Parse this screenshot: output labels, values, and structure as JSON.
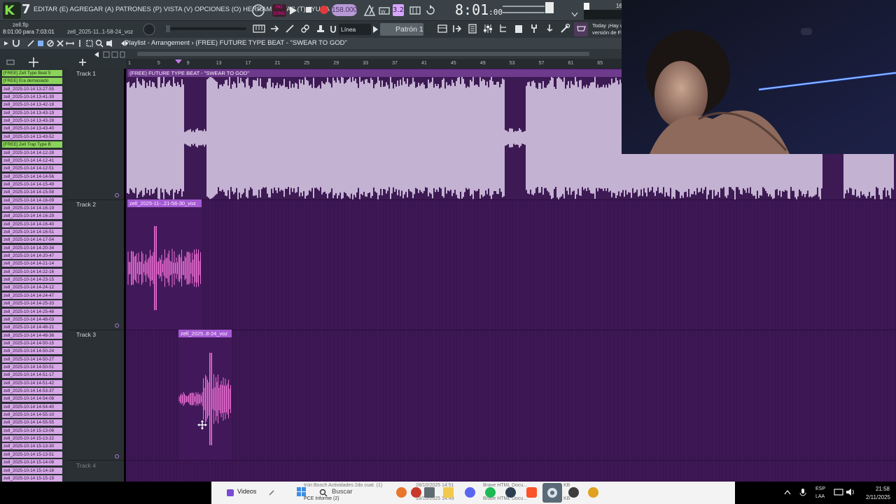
{
  "app": {
    "menu_text": "EDITAR (E)  AGREGAR (A)  PATRONES (P)  VISTA (V)  OPCIONES (O)  HERRAMIENTAS (T)  AYUDA",
    "tempo": "158.000",
    "song_time": "8:01",
    "song_time_frac": ":00",
    "file_name": "zell.flp",
    "time_info": "8:01:00 para 7:03:01",
    "voz_hint": "zell_2025-11..1-58-24_voz",
    "snap_mode": "Línea",
    "pattern": "Patrón 1",
    "today_line1": "Today  ¡Hay u",
    "today_line2": "versión de FL",
    "pattern_num": "3.2",
    "counter": "16"
  },
  "playlist": {
    "title": "Playlist - Arrangement  ›  (FREE) FUTURE TYPE BEAT - \"SWEAR TO GOD\"",
    "ruler": [
      "1",
      "5",
      "9",
      "13",
      "17",
      "21",
      "25",
      "29",
      "33",
      "37",
      "41",
      "45",
      "49",
      "53",
      "57",
      "61",
      "65",
      "67"
    ],
    "tracks": [
      "Track 1",
      "Track 2",
      "Track 3",
      "Track 4"
    ],
    "clips": {
      "track1": "(FREE) FUTURE TYPE BEAT - \"SWEAR TO GOD\"",
      "track2": "zell_2025-11-..21-56-30_voz",
      "track3": "zell_2025..8-24_voz"
    }
  },
  "browser": {
    "items": [
      {
        "label": "[FREE] Zell Type Beat 5",
        "color": "green"
      },
      {
        "label": "[FREE] Era demasiado",
        "color": "green"
      },
      {
        "label": "zell_2025-10-14 13-27-55",
        "color": "pink"
      },
      {
        "label": "zell_2025-10-14 13-41-39",
        "color": "pink"
      },
      {
        "label": "zell_2025-10-14 13-42-18",
        "color": "pink"
      },
      {
        "label": "zell_2025-10-14 13-43-19",
        "color": "pink"
      },
      {
        "label": "zell_2025-10-14 13-43-28",
        "color": "pink"
      },
      {
        "label": "zell_2025-10-14 13-43-40",
        "color": "pink"
      },
      {
        "label": "zell_2025-10-14 13-43-52",
        "color": "pink"
      },
      {
        "label": "[FREE] Zell Trap Type B",
        "color": "green"
      },
      {
        "label": "zell_2025-10-14 14-12-28",
        "color": "pink"
      },
      {
        "label": "zell_2025-10-14 14-12-41",
        "color": "pink"
      },
      {
        "label": "zell_2025-10-14 14-12-51",
        "color": "pink"
      },
      {
        "label": "zell_2025-10-14 14-14-56",
        "color": "pink"
      },
      {
        "label": "zell_2025-10-14 14-15-49",
        "color": "pink"
      },
      {
        "label": "zell_2025-10-14 14-15-58",
        "color": "pink"
      },
      {
        "label": "zell_2025-10-14 14-16-09",
        "color": "pink"
      },
      {
        "label": "zell_2025-10-14 14-16-19",
        "color": "pink"
      },
      {
        "label": "zell_2025-10-14 14-16-29",
        "color": "pink"
      },
      {
        "label": "zell_2025-10-14 14-16-40",
        "color": "pink"
      },
      {
        "label": "zell_2025-10-14 14-16-51",
        "color": "pink"
      },
      {
        "label": "zell_2025-10-14 14-17-54",
        "color": "pink"
      },
      {
        "label": "zell_2025-10-14 14-20-34",
        "color": "pink"
      },
      {
        "label": "zell_2025-10-14 14-20-47",
        "color": "pink"
      },
      {
        "label": "zell_2025-10-14 14-21-14",
        "color": "pink"
      },
      {
        "label": "zell_2025-10-14 14-22-16",
        "color": "pink"
      },
      {
        "label": "zell_2025-10-14 14-23-15",
        "color": "pink"
      },
      {
        "label": "zell_2025-10-14 14-24-12",
        "color": "pink"
      },
      {
        "label": "zell_2025-10-14 14-24-47",
        "color": "pink"
      },
      {
        "label": "zell_2025-10-14 14-25-33",
        "color": "pink"
      },
      {
        "label": "zell_2025-10-14 14-25-48",
        "color": "pink"
      },
      {
        "label": "zell_2025-10-14 14-48-03",
        "color": "pink"
      },
      {
        "label": "zell_2025-10-14 14-48-21",
        "color": "pink"
      },
      {
        "label": "zell_2025-10-14 14-48-36",
        "color": "pink"
      },
      {
        "label": "zell_2025-10-14 14-50-15",
        "color": "pink"
      },
      {
        "label": "zell_2025-10-14 14-50-24",
        "color": "pink"
      },
      {
        "label": "zell_2025-10-14 14-50-27",
        "color": "pink"
      },
      {
        "label": "zell_2025-10-14 14-50-51",
        "color": "pink"
      },
      {
        "label": "zell_2025-10-14 14-51-17",
        "color": "pink"
      },
      {
        "label": "zell_2025-10-14 14-51-42",
        "color": "pink"
      },
      {
        "label": "zell_2025-10-14 14-53-37",
        "color": "pink"
      },
      {
        "label": "zell_2025-10-14 14-54-08",
        "color": "pink"
      },
      {
        "label": "zell_2025-10-14 14-54-40",
        "color": "pink"
      },
      {
        "label": "zell_2025-10-14 14-55-10",
        "color": "pink"
      },
      {
        "label": "zell_2025-10-14 14-55-55",
        "color": "pink"
      },
      {
        "label": "zell_2025-10-14 15-13-06",
        "color": "pink"
      },
      {
        "label": "zell_2025-10-14 15-13-22",
        "color": "pink"
      },
      {
        "label": "zell_2025-10-14 15-13-30",
        "color": "pink"
      },
      {
        "label": "zell_2025-10-14 15-13-51",
        "color": "pink"
      },
      {
        "label": "zell_2025-10-14 15-14-08",
        "color": "pink"
      },
      {
        "label": "zell_2025-10-14 15-14-16",
        "color": "pink"
      },
      {
        "label": "zell_2025-10-14 15-15-19",
        "color": "pink"
      },
      {
        "label": "zell_2025-10-14 15-15-30",
        "color": "pink"
      }
    ]
  },
  "taskbar": {
    "videos": "Videos",
    "search": "Buscar",
    "item1": "Irún Bosch Actividades 2do cuat. (1)",
    "item1_time": "28/10/2025 14:51",
    "item2": "PCE Informe (2)",
    "item2_time": "28/10/2025 14:49",
    "brave1": "Brave HTML Docu...",
    "brave2": "Brave HTML Docu...",
    "kb1": "KB",
    "kb2": "KB",
    "lang": "ESP",
    "lang2": "LAA",
    "clock": "21:58",
    "date": "2/11/2025"
  },
  "colors": {
    "arrangement_bg": "#3a1650",
    "audio_wave": "#e7d8f2",
    "vocal_wave": "#f06fd6",
    "clip_header": "#a55ad4"
  }
}
